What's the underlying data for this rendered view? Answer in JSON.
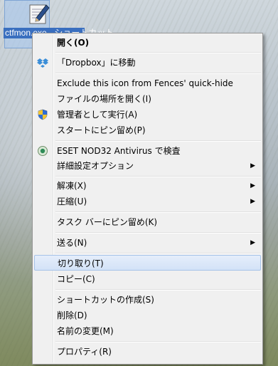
{
  "desktop": {
    "icon_caption": "ctfmon.exe - ショートカット"
  },
  "menu": {
    "open": "開く(O)",
    "dropbox_move": "「Dropbox」に移動",
    "fences_exclude": "Exclude this icon from Fences' quick-hide",
    "open_file_location": "ファイルの場所を開く(I)",
    "run_as_admin": "管理者として実行(A)",
    "pin_to_start": "スタートにピン留め(P)",
    "eset_scan": "ESET NOD32 Antivirus で検査",
    "advanced_options": "詳細設定オプション",
    "extract": "解凍(X)",
    "compress": "圧縮(U)",
    "pin_to_taskbar": "タスク バーにピン留め(K)",
    "send_to": "送る(N)",
    "cut": "切り取り(T)",
    "copy": "コピー(C)",
    "create_shortcut": "ショートカットの作成(S)",
    "delete": "削除(D)",
    "rename": "名前の変更(M)",
    "properties": "プロパティ(R)"
  },
  "colors": {
    "menu_bg": "#f0f0f0",
    "hover_bg": "#d3e2f7",
    "hover_border": "#a6c2e8"
  }
}
